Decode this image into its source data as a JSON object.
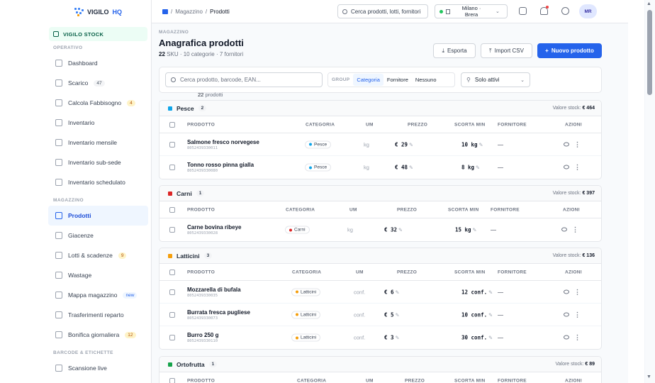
{
  "brand": {
    "name": "VIGILO",
    "suffix": "HQ"
  },
  "shop": {
    "label": "VIGILO STOCK"
  },
  "sidebar": {
    "sections": [
      {
        "title": "OPERATIVO",
        "items": [
          {
            "label": "Dashboard",
            "icon": "gauge-icon"
          },
          {
            "label": "Scarico",
            "badge": "47",
            "icon": "arrow-up-circle-icon"
          },
          {
            "label": "Calcola Fabbisogno",
            "badge": "4",
            "badge_color": "orange",
            "icon": "calculator-icon"
          },
          {
            "label": "Inventario",
            "icon": "clipboard-icon"
          },
          {
            "label": "Inventario mensile",
            "icon": "calendar-icon"
          },
          {
            "label": "Inventario sub-sede",
            "icon": "sitemap-icon"
          },
          {
            "label": "Inventario schedulato",
            "icon": "calendar-grid-icon"
          }
        ]
      },
      {
        "title": "MAGAZZINO",
        "items": [
          {
            "label": "Prodotti",
            "active": true,
            "icon": "box-icon"
          },
          {
            "label": "Giacenze",
            "icon": "archive-icon"
          },
          {
            "label": "Lotti & scadenze",
            "badge": "9",
            "badge_color": "orange",
            "icon": "barcode-icon"
          },
          {
            "label": "Wastage",
            "icon": "trash-icon"
          },
          {
            "label": "Mappa magazzino",
            "badge": "new",
            "badge_color": "blue",
            "icon": "map-icon"
          },
          {
            "label": "Trasferimenti reparto",
            "icon": "transfer-icon"
          },
          {
            "label": "Bonifica giornaliera",
            "badge": "12",
            "badge_color": "orange",
            "icon": "shield-icon"
          }
        ]
      },
      {
        "title": "BARCODE & ETICHETTE",
        "items": [
          {
            "label": "Scansione live",
            "icon": "scan-icon"
          }
        ]
      }
    ]
  },
  "breadcrumb": {
    "parent": "Magazzino",
    "current": "Prodotti"
  },
  "topbar": {
    "search_value": "Cerca prodotti, lotti, fornitori",
    "location_line1": "Milano ·",
    "location_line2": "Brera",
    "avatar": "MR"
  },
  "page": {
    "eyebrow": "MAGAZZINO",
    "title": "Anagrafica prodotti",
    "sku_count": "22",
    "subtitle_rest": "SKU · 10 categorie · 7 fornitori",
    "export_label": "Esporta",
    "import_label": "Import CSV",
    "new_label": "Nuovo prodotto"
  },
  "filters": {
    "search_placeholder": "Cerca prodotto, barcode, EAN...",
    "group_label": "GROUP",
    "group_options": [
      "Categoria",
      "Fornitore",
      "Nessuno"
    ],
    "status_value": "Solo attivi",
    "count_value": "22",
    "count_label": "prodotti"
  },
  "columns": {
    "product": "PRODOTTO",
    "category": "CATEGORIA",
    "um": "UM",
    "price": "PREZZO",
    "min_stock": "SCORTA MIN",
    "supplier": "FORNITORE",
    "actions": "AZIONI"
  },
  "stock_value_label": "Valore stock:",
  "groups": [
    {
      "name": "Pesce",
      "count": "2",
      "color": "#0ea5e9",
      "value": "€ 464",
      "rows": [
        {
          "name": "Salmone fresco norvegese",
          "code": "8052439330011",
          "category": "Pesce",
          "um": "kg",
          "price": "€ 29",
          "min": "10 kg",
          "supplier": "—"
        },
        {
          "name": "Tonno rosso pinna gialla",
          "code": "8052439330080",
          "category": "Pesce",
          "um": "kg",
          "price": "€ 48",
          "min": "8 kg",
          "supplier": "—"
        }
      ]
    },
    {
      "name": "Carni",
      "count": "1",
      "color": "#dc2626",
      "value": "€ 397",
      "rows": [
        {
          "name": "Carne bovina ribeye",
          "code": "8052439330028",
          "category": "Carni",
          "um": "kg",
          "price": "€ 32",
          "min": "15 kg",
          "supplier": "—"
        }
      ]
    },
    {
      "name": "Latticini",
      "count": "3",
      "color": "#f59e0b",
      "value": "€ 136",
      "rows": [
        {
          "name": "Mozzarella di bufala",
          "code": "8052439330035",
          "category": "Latticini",
          "um": "conf.",
          "price": "€ 6",
          "min": "12 conf.",
          "supplier": "—"
        },
        {
          "name": "Burrata fresca pugliese",
          "code": "8052439330073",
          "category": "Latticini",
          "um": "conf.",
          "price": "€ 5",
          "min": "10 conf.",
          "supplier": "—"
        },
        {
          "name": "Burro 250 g",
          "code": "8052439330110",
          "category": "Latticini",
          "um": "conf.",
          "price": "€ 3",
          "min": "30 conf.",
          "supplier": "—"
        }
      ]
    },
    {
      "name": "Ortofrutta",
      "count": "1",
      "color": "#16a34a",
      "value": "€ 89",
      "rows": []
    }
  ]
}
